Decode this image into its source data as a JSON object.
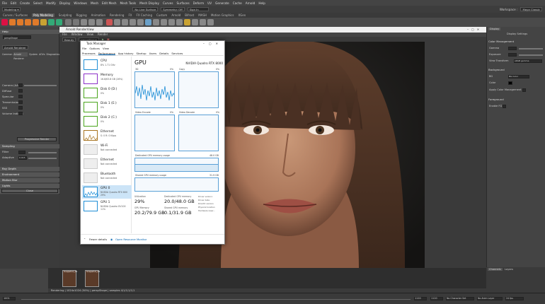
{
  "maya": {
    "menus": [
      "File",
      "Edit",
      "Create",
      "Select",
      "Modify",
      "Display",
      "Windows",
      "Mesh",
      "Edit Mesh",
      "Mesh Tools",
      "Mesh Display",
      "Curves",
      "Surfaces",
      "Deform",
      "UV",
      "Generate",
      "Cache",
      "Arnold",
      "Help"
    ],
    "shelf_tabs": [
      "Curves / Surfaces",
      "Poly Modeling",
      "Sculpting",
      "Rigging",
      "Animation",
      "Rendering",
      "FX",
      "FX Caching",
      "Custom",
      "Arnold",
      "Bifrost",
      "MASH",
      "Motion Graphics",
      "XGen"
    ],
    "active_shelf_tab": "Poly Modeling",
    "no_live_surface": "No Live Surface",
    "symmetry": "Symmetry: Off",
    "sign_in": "Sign In",
    "workspace_label": "Workspace :",
    "workspace_value": "Maya Classic"
  },
  "left_panel": {
    "help": "Help",
    "camera_value": "perspShape",
    "renderer": "Arnold Renderer",
    "tabs": [
      "Common",
      "Arnold Renderer",
      "System",
      "AOVs",
      "Diagnostics"
    ],
    "rows": [
      "Camera (AA)",
      "Diffuse",
      "Specular",
      "Transmission",
      "SSS",
      "Volume Indirect"
    ],
    "render_button": "Progressive Render",
    "sampling": "Sampling",
    "filter_label": "Filter",
    "adaptive_threshold": "Adaptive Threshold",
    "adaptive_value": "0.015",
    "sections": [
      "Ray Depth",
      "Environment",
      "Motion Blur",
      "Lights",
      "Textures",
      "Features"
    ],
    "close_button": "Close"
  },
  "render_view": {
    "title": "Arnold RenderView",
    "menus": [
      "File",
      "Window",
      "View",
      "Render"
    ],
    "toolbar_renderer": "Beauty",
    "toolbar_camera": "perspShape",
    "snapshots": [
      "Snapshot_01",
      "Snapshot_02"
    ],
    "status": "Rendering | 1024x1024 (50%) | perspShape | samples 4/1/1/1/1/1"
  },
  "right_panel": {
    "tabs": [
      "Display",
      "Display Settings"
    ],
    "color_management": "Color Management",
    "gamma": "Gamma",
    "exposure": "Exposure",
    "view_transform": "View Transform",
    "view_transform_value": "sRGB gamma",
    "background": "Background",
    "bg_label": "BG",
    "bg_value": "BG Color",
    "color_label": "Color",
    "apply_cm": "Apply Color Management",
    "foreground": "Foreground",
    "enable_fg": "Enable FG",
    "lower_tabs": [
      "Channels",
      "Layers"
    ]
  },
  "timebar": {
    "start": "1001",
    "end": "1120",
    "range_start": "1120",
    "range_end": "1120",
    "character_set": "No Character Set",
    "anim_layer": "No Anim Layer",
    "fps": "24 fps"
  },
  "task_manager": {
    "title": "Task Manager",
    "menus": [
      "File",
      "Options",
      "View"
    ],
    "tabs": [
      "Processes",
      "Performance",
      "App history",
      "Startup",
      "Users",
      "Details",
      "Services"
    ],
    "active_tab": "Performance",
    "side_items": [
      {
        "name": "CPU",
        "sub": "8%  1.71 GHz",
        "sub2": ""
      },
      {
        "name": "Memory",
        "sub": "16.8/63.8 GB (26%)",
        "sub2": ""
      },
      {
        "name": "Disk 0 (D:)",
        "sub": "0%",
        "sub2": ""
      },
      {
        "name": "Disk 1 (E:)",
        "sub": "0%",
        "sub2": ""
      },
      {
        "name": "Disk 2 (C:)",
        "sub": "0%",
        "sub2": ""
      },
      {
        "name": "Ethernet",
        "sub": "S: 0  R: 0 Kbps",
        "sub2": ""
      },
      {
        "name": "Wi-Fi",
        "sub": "Not connected",
        "sub2": ""
      },
      {
        "name": "Ethernet",
        "sub": "Not connected",
        "sub2": ""
      },
      {
        "name": "Bluetooth",
        "sub": "Not connected",
        "sub2": ""
      },
      {
        "name": "GPU 0",
        "sub": "NVIDIA Quadro RTX 800",
        "sub2": "29%"
      },
      {
        "name": "GPU 1",
        "sub": "NVIDIA Quadro GV100",
        "sub2": "11%"
      }
    ],
    "gpu_title": "GPU",
    "gpu_model": "NVIDIA Quadro RTX 8000",
    "graphs": [
      {
        "label": "3D",
        "pct": "0%"
      },
      {
        "label": "Copy",
        "pct": "0%"
      },
      {
        "label": "Video Encode",
        "pct": "0%"
      },
      {
        "label": "Video Decode",
        "pct": "0%"
      }
    ],
    "dedicated_label": "Dedicated GPU memory usage",
    "dedicated_max": "48.0 GB",
    "shared_label": "Shared GPU memory usage",
    "shared_max": "31.9 GB",
    "utilization_label": "Utilization",
    "utilization": "29%",
    "dedicated_mem_label": "Dedicated GPU memory",
    "dedicated_mem": "20.0/48.0 GB",
    "gpu_memory_label": "GPU Memory",
    "gpu_memory": "20.2/79.9 GB",
    "shared_mem_label": "Shared GPU memory",
    "shared_mem": "0.1/31.9 GB",
    "driver_labels": [
      "Driver version:",
      "Driver date:",
      "DirectX version:",
      "Physical location:",
      "Hardware reser..."
    ],
    "fewer_details": "Fewer details",
    "open_monitor": "Open Resource Monitor",
    "colors": {
      "cpu": "#1f8ed6",
      "memory": "#8b2fc9",
      "disk": "#4aa51c",
      "ethernet": "#a87420",
      "gpu": "#1f8ed6"
    }
  }
}
